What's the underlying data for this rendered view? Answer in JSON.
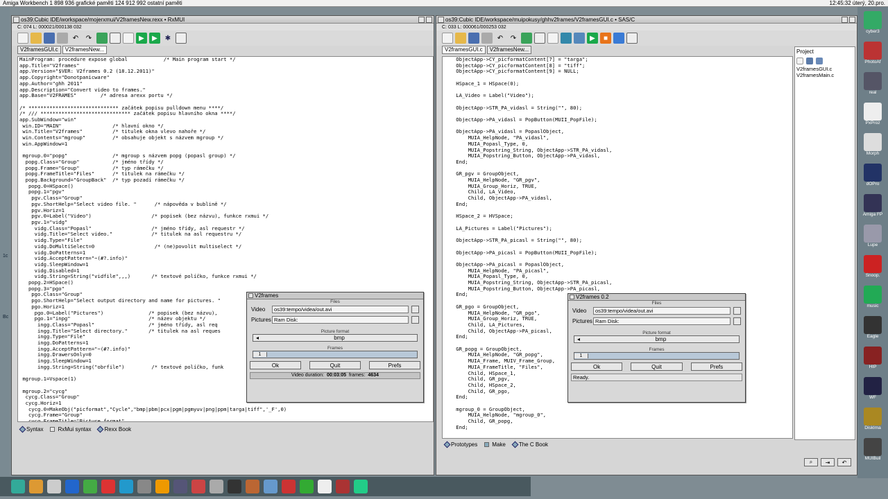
{
  "menubar": {
    "left": "Amiga Workbench   1 898 936 grafické paměti   124 912 992 ostatní paměti",
    "right": "12:45:32 úterý, 20.pro."
  },
  "left_window": {
    "title": "os39:Cubic IDE/workspace/mojerxmui/V2framesNew.rexx • RxMUI",
    "status": "C: 074  L: 000021/000138  032",
    "tabs": [
      "V2framesGUI.c",
      "V2framesNew..."
    ],
    "code": [
      "MainProgram: procedure expose global            /* Main program start */",
      "app.Title=\"V2frames\"",
      "app.Version=\"$VER: V2frames 0.2 (18.12.2011)\"",
      "app.Copyright=\"Donotpanicware\"",
      "app.Author=\"ghh 2011\"",
      "app.Description=\"Convert video to frames.\"",
      "app.Base=\"V2FRAMES\"        /* adresa arexx portu */",
      "",
      "/* ****************************** začátek popisu pulldown menu ****/",
      "/* /// ****************************** začátek popisu hlavního okna ****/",
      "app.SubWindow=\"win\"",
      " win.ID=\"MAIN\"                 /* hlavní okno */",
      " win.Title=\"V2frames\"          /* titulek okna vlevo nahoře */",
      " win.Contents=\"mgroup\"         /* obsahuje objekt s názvem mgroup */",
      " win.AppWindow=1",
      "",
      " mgroup.0=\"popg\"               /* mgroup s názvem popg (popasl group) */",
      "  popg.Class=\"Group\"           /* jméno třídy */",
      "  popg.Frame=\"Group\"           /* typ rámečku */",
      "  popg.FrameTitle=\"Files\"      /* titulek na rámečku */",
      "  popg.Background=\"GroupBack\"  /* typ pozadí rámečku */",
      "   popg.0=HSpace()",
      "   popg.1=\"pgv\"",
      "    pgv.Class=\"Group\"",
      "    pgv.ShortHelp=\"Select video file. \"      /* nápověda v bublině */",
      "    pgv.Horiz=1",
      "    pgv.0=Label(\"Video\")                    /* popisek (bez názvu), funkce rxmui */",
      "    pgv.1=\"vidg\"",
      "     vidg.Class=\"Popasl\"                    /* jméno třídy, asl requestr */",
      "     vidg.Title=\"Select video.\"             /* titulek na asl requestru */",
      "     vidg.Type=\"File\"",
      "     vidg.DoMultiSelect=0                    /* (ne)povolit multiselect */",
      "     vidg.DoPatterns=1",
      "     vidg.AcceptPattern=\"~(#?.info)\"",
      "     vidg.SleepWindow=1",
      "     vidg.Disabled=1",
      "     vidg.String=String(\"vidfile\",,,)       /* textové políčko, funkce rxmui */",
      "   popg.2=HSpace()",
      "   popg.3=\"pgo\"",
      "    pgo.Class=\"Group\"",
      "    pgo.ShortHelp=\"Select output directory and name for pictures. \"",
      "    pgo.Horiz=1",
      "     pgo.0=Label(\"Pictures\")               /* popisek (bez názvu),",
      "     pgo.1=\"inpg\"                          /* název objektu */",
      "      ingg.Class=\"Popasl\"                  /* jméno třídy, asl req",
      "      ingg.Title=\"Select directory.\"       /* titulek na asl reques",
      "      ingg.Type=\"File\"",
      "      ingg.DoPatterns=1",
      "      ingg.AcceptPattern=\"~(#?.info)\"",
      "      ingg.DrawersOnly=0",
      "      ingg.SleepWindow=1",
      "      ingg.String=String(\"obrfile\")         /* textové políčko, funk",
      "",
      " mgroup.1=Vspace(1)",
      "",
      " mgroup.2=\"cycg\"",
      "  cycg.Class=\"Group\"",
      "  cycg.Horiz=1",
      "   cycg.0=MakeObj(\"picformat\",\"Cycle\",\"bmp|pbm|pcx|pgm|pgmyuv|png|ppm|targa|tiff\",'_F',0)",
      "   cycg.Frame=\"Group\"",
      "   cycg.FrameTitle=\"Picture format\""
    ],
    "bottom_tabs": [
      "Syntax",
      "RxMui syntax",
      "Rexx Book"
    ]
  },
  "right_window": {
    "title": "os39:Cubic IDE/workspace/muipokusy/ghhv2frames/V2framesGUI.c • SAS/C",
    "status": "C: 033  L: 000061/000253  032",
    "tabs": [
      "V2framesGUI.c",
      "V2framesNew..."
    ],
    "code": [
      "    ObjectApp->CY_picformatContent[7] = \"targa\";",
      "    ObjectApp->CY_picformatContent[8] = \"tiff\";",
      "    ObjectApp->CY_picformatContent[9] = NULL;",
      "",
      "    HSpace_1 = HSpace(0);",
      "",
      "    LA_Video = Label(\"Video\");",
      "",
      "    ObjectApp->STR_PA_vidasl = String(\"\", 80);",
      "",
      "    ObjectApp->PA_vidasl = PopButton(MUII_PopFile);",
      "",
      "    ObjectApp->PA_vidasl = PopaslObject,",
      "        MUIA_HelpNode, \"PA_vidasl\",",
      "        MUIA_Popasl_Type, 0,",
      "        MUIA_Popstring_String, ObjectApp->STR_PA_vidasl,",
      "        MUIA_Popstring_Button, ObjectApp->PA_vidasl,",
      "    End;",
      "",
      "    GR_pgv = GroupObject,",
      "        MUIA_HelpNode, \"GR_pgv\",",
      "        MUIA_Group_Horiz, TRUE,",
      "        Child, LA_Video,",
      "        Child, ObjectApp->PA_vidasl,",
      "    End;",
      "",
      "    HSpace_2 = HVSpace;",
      "",
      "    LA_Pictures = Label(\"Pictures\");",
      "",
      "    ObjectApp->STR_PA_picasl = String(\"\", 80);",
      "",
      "    ObjectApp->PA_picasl = PopButton(MUII_PopFile);",
      "",
      "    ObjectApp->PA_picasl = PopaslObject,",
      "        MUIA_HelpNode, \"PA_picasl\",",
      "        MUIA_Popasl_Type, 0,",
      "        MUIA_Popstring_String, ObjectApp->STR_PA_picasl,",
      "        MUIA_Popstring_Button, ObjectApp->PA_picasl,",
      "    End;",
      "",
      "    GR_pgo = GroupObject,",
      "        MUIA_HelpNode, \"GR_pgo\",",
      "        MUIA_Group_Horiz, TRUE,",
      "        Child, LA_Pictures,",
      "        Child, ObjectApp->PA_picasl,",
      "    End;",
      "",
      "    GR_popg = GroupObject,",
      "        MUIA_HelpNode, \"GR_popg\",",
      "        MUIA_Frame, MUIV_Frame_Group,",
      "        MUIA_FrameTitle, \"Files\",",
      "        Child, HSpace_1,",
      "        Child, GR_pgv,",
      "        Child, HSpace_2,",
      "        Child, GR_pgo,",
      "    End;",
      "",
      "    mgroup_0 = GroupObject,",
      "        MUIA_HelpNode, \"mgroup_0\",",
      "        Child, GR_popg,",
      "    End;"
    ],
    "project_title": "Project",
    "project_files": [
      "V2framesGUI.c",
      "V2framesMain.c"
    ],
    "bottom_tabs": [
      "Prototypes",
      "Make",
      "The C Book"
    ]
  },
  "dialog1": {
    "title": "V2frames",
    "group_files": "Files",
    "video_label": "Video",
    "video_value": "os39:tempo/videa/out.avi",
    "pictures_label": "Pictures",
    "pictures_value": "Ram Disk:",
    "format_title": "Picture format",
    "format_value": "bmp",
    "frames_title": "Frames",
    "frames_value": "1",
    "ok": "Ok",
    "quit": "Quit",
    "prefs": "Prefs",
    "duration_label": "Video duration:",
    "duration_value": "00:03:05",
    "frames_label": "frames:",
    "frames_count": "4634"
  },
  "dialog2": {
    "title": "V2frames 0.2",
    "group_files": "Files",
    "video_label": "Video",
    "video_value": "os39:tempo/videa/out.avi",
    "pictures_label": "Pictures",
    "pictures_value": "Ram Disk:",
    "format_title": "Picture format",
    "format_value": "bmp",
    "frames_title": "Frames",
    "frames_value": "1",
    "ok": "Ok",
    "quit": "Quit",
    "prefs": "Prefs",
    "status": "Ready."
  },
  "dock": [
    {
      "label": "cyber3",
      "color": "#3a6"
    },
    {
      "label": "PhotoAf",
      "color": "#b33"
    },
    {
      "label": "real",
      "color": "#556"
    },
    {
      "label": "PxProz",
      "color": "#eee"
    },
    {
      "label": "Morph",
      "color": "#ddd"
    },
    {
      "label": "dOPro",
      "color": "#236"
    },
    {
      "label": "Amiga FP",
      "color": "#335"
    },
    {
      "label": "Lupe",
      "color": "#99a"
    },
    {
      "label": "Snoop.",
      "color": "#c22"
    },
    {
      "label": "music",
      "color": "#2a5"
    },
    {
      "label": "Eagle",
      "color": "#333"
    },
    {
      "label": "HIP",
      "color": "#822"
    },
    {
      "label": "WF",
      "color": "#224"
    },
    {
      "label": "DiskIma",
      "color": "#a82"
    },
    {
      "label": "MUIBuil",
      "color": "#444"
    }
  ],
  "taskbar": [
    "#3a9",
    "#d93",
    "#ccc",
    "#26c",
    "#4a4",
    "#d33",
    "#29c",
    "#888",
    "#e90",
    "#557",
    "#c44",
    "#aaa",
    "#333",
    "#b63",
    "#69c",
    "#c33",
    "#3a3",
    "#eee",
    "#a33",
    "#2c8"
  ],
  "leftstrip": {
    "a": "1c",
    "b": "Bc"
  }
}
